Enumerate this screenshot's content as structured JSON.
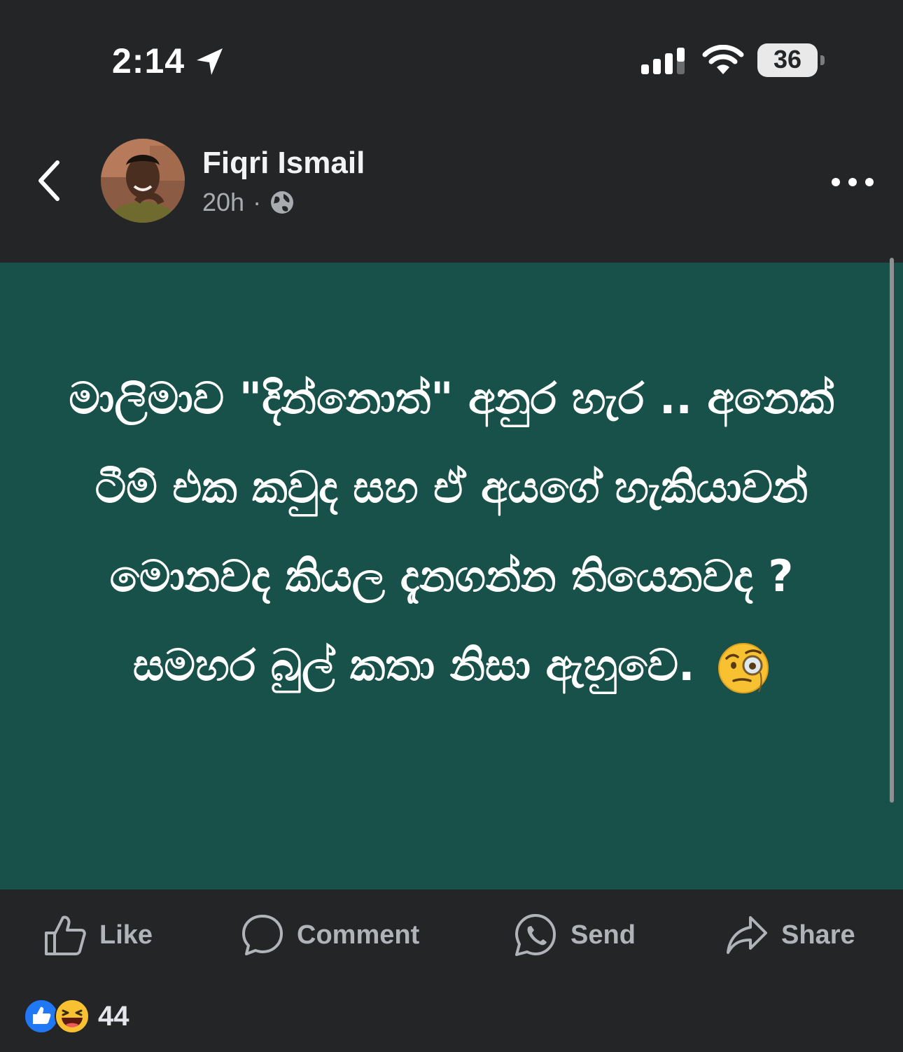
{
  "status_bar": {
    "time": "2:14",
    "battery": "36",
    "icons": [
      "location-arrow-icon",
      "cellular-signal-icon",
      "wifi-icon",
      "battery-icon"
    ]
  },
  "header": {
    "author": "Fiqri Ismail",
    "time_ago": "20h",
    "separator": "·",
    "icons": [
      "chevron-left-icon",
      "globe-icon",
      "more-options-icon"
    ]
  },
  "post": {
    "background_color": "#18514a",
    "text": "මාලිමාව \"දින්නොත්\" අනුර හැර .. අනෙක් ටීම් එක කවුද සහ ඒ අයගේ හැකියාවන් මොනවද කියල දැනගන්න තියෙනවද ? සමහර බුල් කතා නිසා ඇහුවෙ.",
    "emoji": "face-with-monocle"
  },
  "actions": {
    "like": "Like",
    "comment": "Comment",
    "send": "Send",
    "share": "Share"
  },
  "reactions": {
    "types": [
      "like",
      "haha"
    ],
    "count": "44"
  }
}
